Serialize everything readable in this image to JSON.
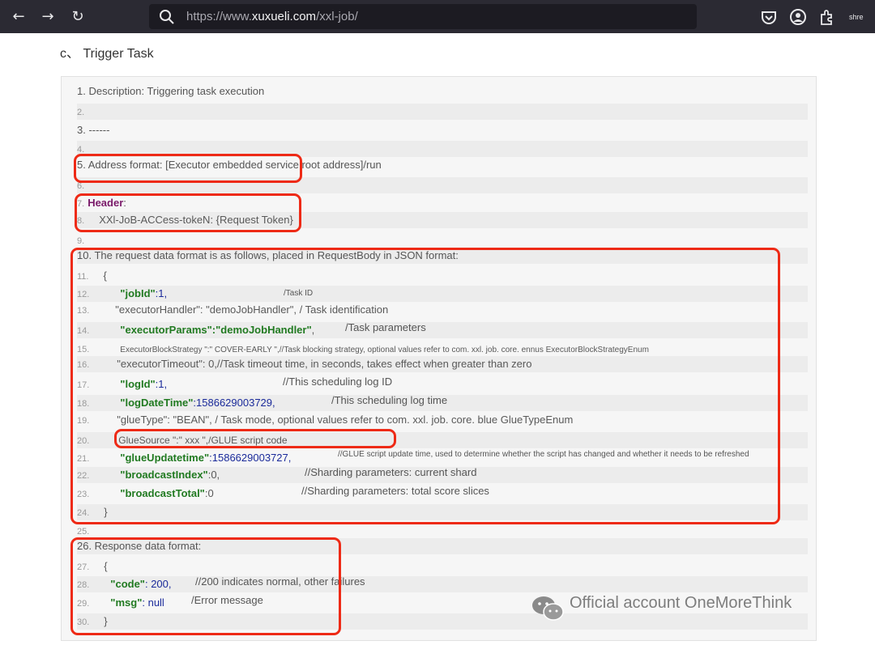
{
  "browser": {
    "url_prefix": "https://www.",
    "url_domain": "xuxueli.com",
    "url_path": "/xxl-job/",
    "back_icon": "arrow-left-icon",
    "forward_icon": "arrow-right-icon",
    "reload_icon": "reload-icon",
    "share_label": "shre"
  },
  "section": {
    "title": "c、 Trigger Task"
  },
  "code": {
    "l1": "1. Description: Triggering task execution",
    "l2": "2.",
    "l3": "3. ------",
    "l4": "4.",
    "l5": "5. Address format: [Executor embedded service root address]/run",
    "l6": "6.",
    "l7_num": "7.",
    "l7_header": "Header",
    "l7_colon": ":",
    "l8_num": "8.",
    "l8_text": "XXl-JoB-ACCess-tokeN: {Request Token}",
    "l9": "9.",
    "l10": "10. The request data format is as follows, placed in RequestBody in JSON format:",
    "l11_num": "11.",
    "l11_text": "{",
    "l12_num": "12.",
    "l12_key": "\"jobId\"",
    "l12_val": ":1,",
    "l12_cmt": "/Task ID",
    "l13_num": "13.",
    "l13_text": "\"executorHandler\": \"demoJobHandler\", / Task identification",
    "l14_num": "14.",
    "l14_key": "\"executorParams\":\"demoJobHandler\"",
    "l14_val": ",",
    "l14_cmt": "/Task parameters",
    "l15_num": "15.",
    "l15_text": "ExecutorBlockStrategy \":\" COVER-EARLY \",//Task blocking strategy, optional values refer to com. xxl. job. core. ennus ExecutorBlockStrategyEnum",
    "l16_num": "16.",
    "l16_text": "\"executorTimeout\":  0,//Task timeout time, in seconds, takes effect when greater than zero",
    "l17_num": "17.",
    "l17_key": "\"logId\"",
    "l17_val": ":1,",
    "l17_cmt": "//This scheduling log ID",
    "l18_num": "18.",
    "l18_key": "\"logDateTime\"",
    "l18_val": ":1586629003729,",
    "l18_cmt": "/This scheduling log time",
    "l19_num": "19.",
    "l19_text": "\"glueType\": \"BEAN\", / Task mode, optional values refer to com. xxl. job. core. blue GlueTypeEnum",
    "l20_num": "20.",
    "l20_text": "GlueSource \":\" xxx \",/GLUE script code",
    "l21_num": "21.",
    "l21_key": "\"glueUpdatetime\"",
    "l21_val": ":1586629003727,",
    "l21_cmt": "//GLUE script update time, used to determine whether the script has changed and whether it needs to be refreshed",
    "l22_num": "22.",
    "l22_key": "\"broadcastIndex\"",
    "l22_val": ":0,",
    "l22_cmt": "//Sharding parameters: current shard",
    "l23_num": "23.",
    "l23_key": "\"broadcastTotal\"",
    "l23_val": ":0",
    "l23_cmt": "//Sharding parameters: total score slices",
    "l24_num": "24.",
    "l24_text": "}",
    "l25": "25.",
    "l26": "26. Response data format:",
    "l27_num": "27.",
    "l27_text": "{",
    "l28_num": "28.",
    "l28_key": "\"code\"",
    "l28_val": ": 200,",
    "l28_cmt": "//200 indicates normal, other failures",
    "l29_num": "29.",
    "l29_key": "\"msg\"",
    "l29_val": ": null",
    "l29_cmt": "/Error message",
    "l30_num": "30.",
    "l30_text": "}"
  },
  "watermark": {
    "text": "Official account OneMoreThink",
    "icon": "wechat-icon"
  },
  "colors": {
    "highlight": "#ee2a16",
    "json_key": "#217a21",
    "header": "#7a1a6a",
    "number": "#1a2a9a"
  }
}
